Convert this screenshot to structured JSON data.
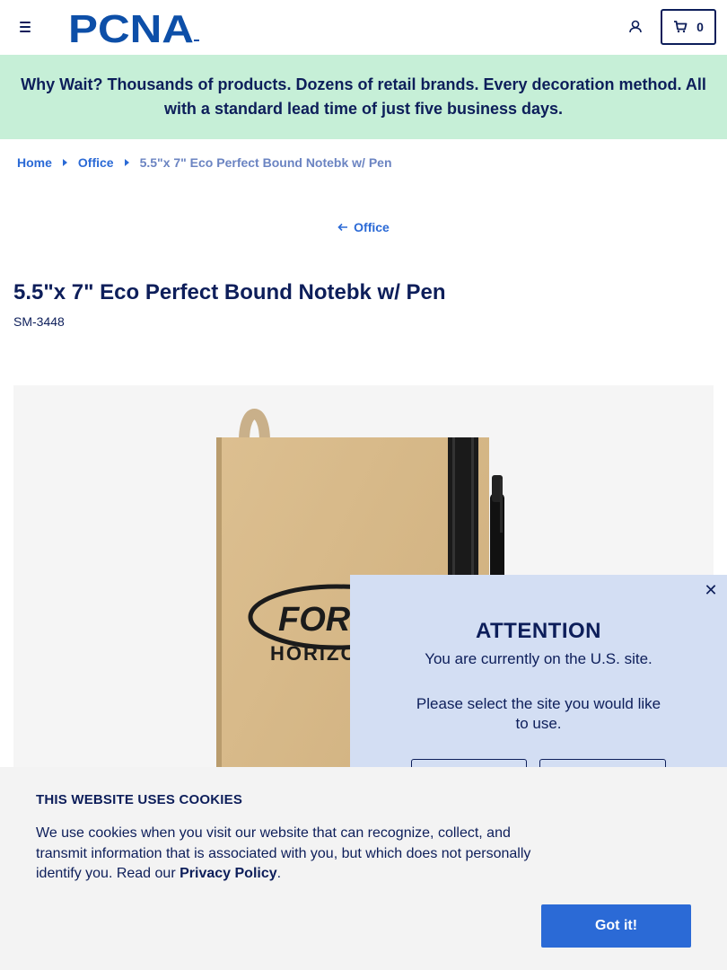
{
  "header": {
    "logo_text": "PCNA",
    "cart_count": "0"
  },
  "promo": {
    "text": "Why Wait? Thousands of products. Dozens of retail brands. Every decoration method. All with a standard lead time of just five business days."
  },
  "breadcrumb": {
    "items": [
      "Home",
      "Office"
    ],
    "current": "5.5\"x 7\" Eco Perfect Bound Notebk w/ Pen"
  },
  "back_link": {
    "label": "Office"
  },
  "product": {
    "title": "5.5\"x 7\" Eco Perfect Bound Notebk w/ Pen",
    "sku": "SM-3448",
    "imprint_text_1": "FOR",
    "imprint_text_2": "HORIZO"
  },
  "attention": {
    "title": "ATTENTION",
    "message": "You are currently on the U.S. site.",
    "prompt": "Please select the site you would like to use."
  },
  "cookies": {
    "title": "THIS WEBSITE USES COOKIES",
    "text": "We use cookies when you visit our website that can recognize, collect, and transmit information that is associated with you, but which does not personally identify you. Read our",
    "link_label": "Privacy Policy",
    "period": ".",
    "button_label": "Got it!"
  },
  "colors": {
    "navy": "#0d1e5a",
    "link_blue": "#2b6ad6",
    "promo_bg": "#c6efd7",
    "attention_bg": "#d3def3",
    "cookie_bg": "#f3f3f3"
  }
}
